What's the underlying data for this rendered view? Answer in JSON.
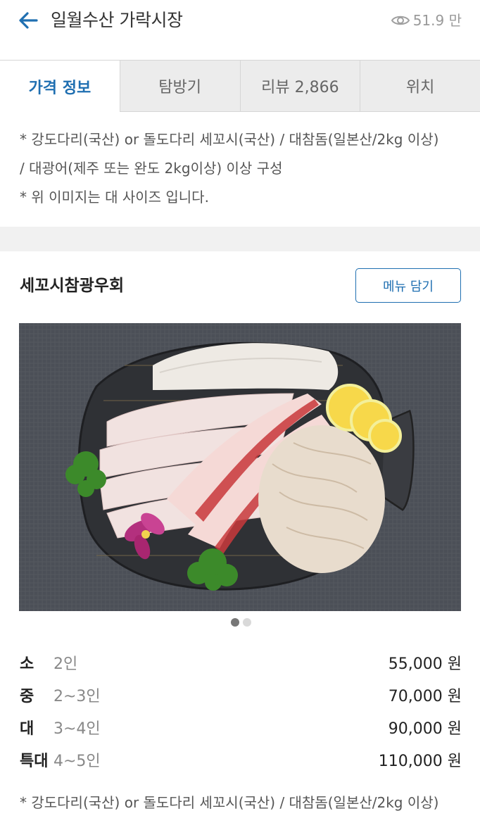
{
  "header": {
    "title": "일월수산 가락시장",
    "views": "51.9 만"
  },
  "tabs": [
    {
      "label": "가격 정보",
      "active": true
    },
    {
      "label": "탐방기",
      "active": false
    },
    {
      "label": "리뷰 2,866",
      "active": false
    },
    {
      "label": "위치",
      "active": false
    }
  ],
  "notes": [
    "* 강도다리(국산) or 돌도다리 세꼬시(국산) / 대참돔(일본산/2kg 이상)",
    "/ 대광어(제주 또는 완도 2kg이상) 이상 구성",
    "* 위 이미지는 대 사이즈 입니다."
  ],
  "menu": {
    "title": "세꼬시참광우회",
    "add_button": "메뉴 담기",
    "image_icon": "sashimi-platter-photo",
    "pager": {
      "count": 2,
      "active": 0
    }
  },
  "prices": [
    {
      "size": "소",
      "people": "2인",
      "amount": "55,000 원"
    },
    {
      "size": "중",
      "people": "2~3인",
      "amount": "70,000 원"
    },
    {
      "size": "대",
      "people": "3~4인",
      "amount": "90,000 원"
    },
    {
      "size": "특대",
      "people": "4~5인",
      "amount": "110,000 원"
    }
  ],
  "bottom_note": "* 강도다리(국산) or 돌도다리 세꼬시(국산) / 대참돔(일본산/2kg 이상)",
  "colors": {
    "accent": "#1f6fb1",
    "tab_inactive_bg": "#ececec",
    "photo_bg": "#4d5058"
  }
}
